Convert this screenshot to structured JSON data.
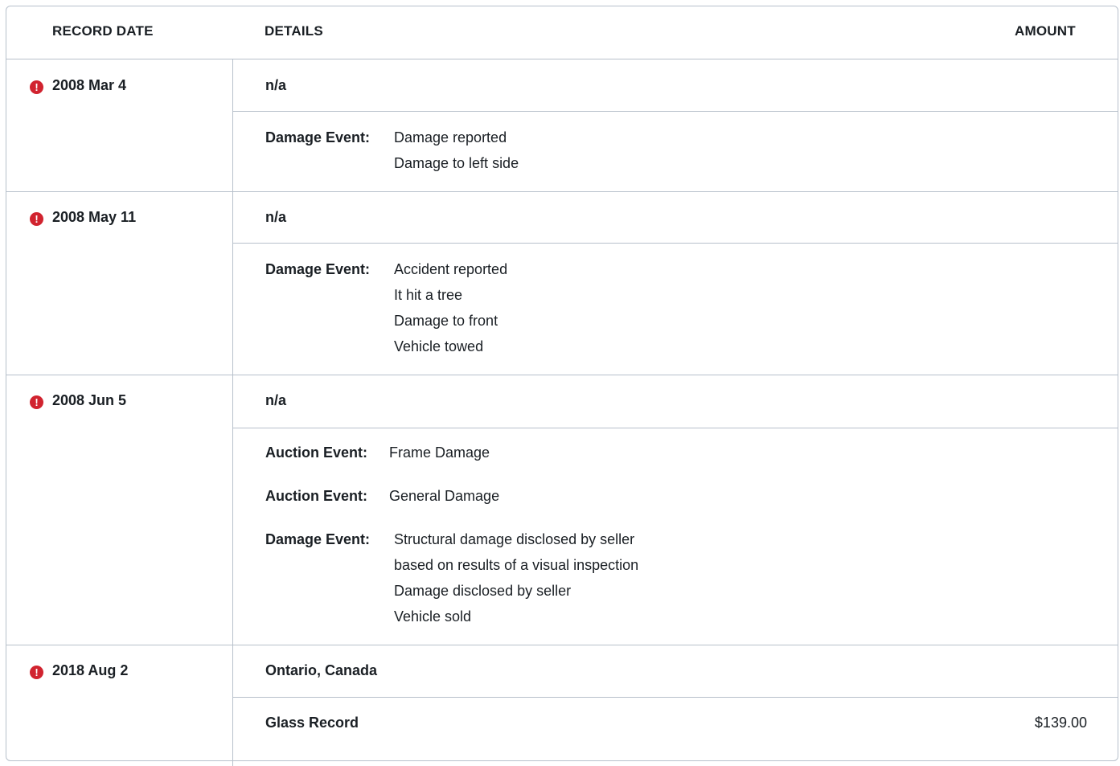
{
  "table": {
    "headers": {
      "record_date": "RECORD DATE",
      "details": "DETAILS",
      "amount": "AMOUNT"
    },
    "records": [
      {
        "date": "2008 Mar 4",
        "location": "n/a",
        "events": [
          {
            "label": "Damage Event:",
            "lines": [
              "Damage reported",
              "Damage to left side"
            ]
          }
        ]
      },
      {
        "date": "2008 May 11",
        "location": "n/a",
        "events": [
          {
            "label": "Damage Event:",
            "lines": [
              "Accident reported",
              "It hit a tree",
              "Damage to front",
              "Vehicle towed"
            ]
          }
        ]
      },
      {
        "date": "2008 Jun 5",
        "location": "n/a",
        "events": [
          {
            "label": "Auction Event:",
            "lines": [
              "Frame Damage"
            ]
          },
          {
            "label": "Auction Event:",
            "lines": [
              "General Damage"
            ]
          },
          {
            "label": "Damage Event:",
            "lines": [
              "Structural damage disclosed by seller",
              "based on results of a visual inspection",
              "Damage disclosed by seller",
              "Vehicle sold"
            ]
          }
        ]
      },
      {
        "date": "2018 Aug 2",
        "location": "Ontario, Canada",
        "events": [
          {
            "label": "Glass Record",
            "amount": "$139.00"
          }
        ]
      }
    ]
  },
  "icons": {
    "alert": "alert-circle-icon",
    "alert_glyph": "!",
    "alert_color": "#d1232f"
  }
}
